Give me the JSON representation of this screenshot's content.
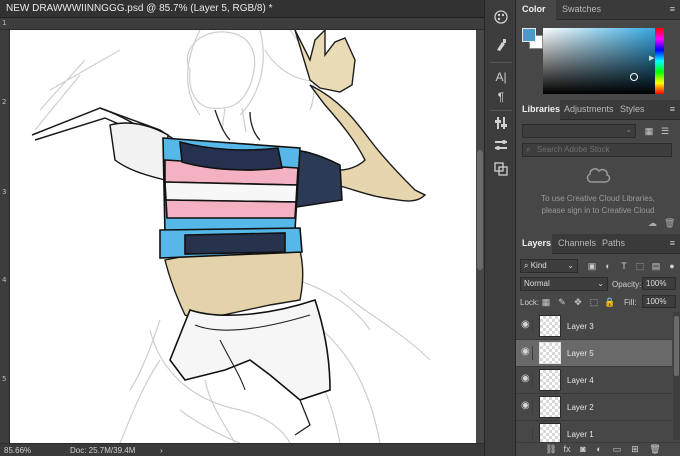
{
  "document": {
    "tab_title": "NEW DRAWWWIINNGGG.psd @ 85.7% (Layer 5, RGB/8) *",
    "ruler_top": [
      "1"
    ],
    "ruler_left": [
      "2",
      "3",
      "4",
      "5"
    ]
  },
  "status_bar": {
    "zoom": "85.66%",
    "doc_size": "Doc: 25.7M/39.4M",
    "arrow": "›"
  },
  "tool_dock": {
    "icons": [
      "palette-icon",
      "brushes-icon",
      "character-icon",
      "paragraph-icon",
      "adjust-icon",
      "properties-icon",
      "paths-icon"
    ]
  },
  "color_panel": {
    "tabs": [
      "Color",
      "Swatches"
    ],
    "active_tab": "Color",
    "foreground_color": "#4a9ac7",
    "background_color": "#ffffff"
  },
  "libraries_panel": {
    "tabs": [
      "Libraries",
      "Adjustments",
      "Styles"
    ],
    "active_tab": "Libraries",
    "search_placeholder": "Search Adobe Stock",
    "message_line1": "To use Creative Cloud Libraries,",
    "message_line2": "please sign in to Creative Cloud"
  },
  "layers_panel": {
    "tabs": [
      "Layers",
      "Channels",
      "Paths"
    ],
    "active_tab": "Layers",
    "filter_kind": "Kind",
    "blend_mode": "Normal",
    "opacity_label": "Opacity:",
    "opacity_value": "100%",
    "lock_label": "Lock:",
    "fill_label": "Fill:",
    "fill_value": "100%",
    "layers": [
      {
        "name": "Layer 3",
        "visible": true,
        "selected": false
      },
      {
        "name": "Layer 5",
        "visible": true,
        "selected": true
      },
      {
        "name": "Layer 4",
        "visible": true,
        "selected": false
      },
      {
        "name": "Layer 2",
        "visible": true,
        "selected": false
      },
      {
        "name": "Layer 1",
        "visible": false,
        "selected": false
      }
    ],
    "footer_icons": [
      "link-icon",
      "fx-icon",
      "mask-icon",
      "adjustment-layer-icon",
      "group-icon",
      "new-layer-icon",
      "trash-icon"
    ]
  },
  "colors": {
    "panel_bg": "#474747",
    "selected_layer": "#696969",
    "accent_blue": "#4a9ac7"
  }
}
